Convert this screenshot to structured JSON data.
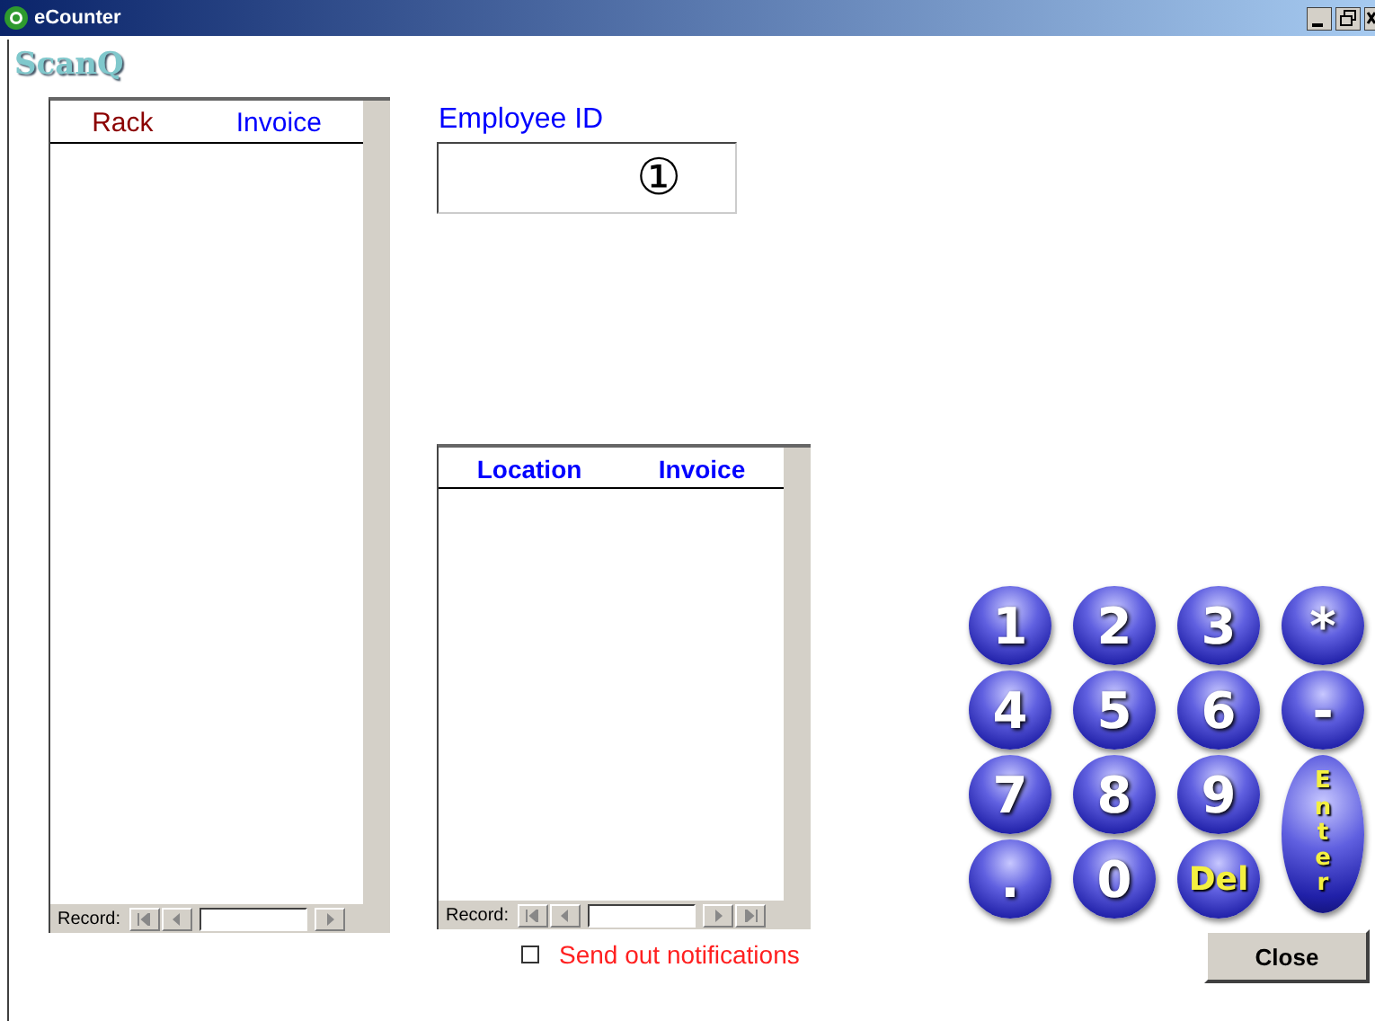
{
  "window": {
    "title": "eCounter"
  },
  "logo": "ScanQ",
  "rack_list": {
    "columns": [
      {
        "label": "Rack",
        "color": "#8b0000"
      },
      {
        "label": "Invoice",
        "color": "#0000ff"
      }
    ],
    "record_label": "Record:",
    "nav": [
      {
        "kind": "first"
      },
      {
        "kind": "prev"
      },
      {
        "kind": "input"
      },
      {
        "kind": "next"
      }
    ]
  },
  "employee": {
    "label": "Employee ID",
    "value": "①"
  },
  "location_list": {
    "columns": [
      {
        "label": "Location",
        "color": "#0000ff"
      },
      {
        "label": "Invoice",
        "color": "#0000ff"
      }
    ],
    "record_label": "Record:",
    "nav": [
      {
        "kind": "first"
      },
      {
        "kind": "prev"
      },
      {
        "kind": "input"
      },
      {
        "kind": "next"
      },
      {
        "kind": "last"
      }
    ]
  },
  "notify": {
    "label": "Send out notifications",
    "checked": false
  },
  "keypad": [
    {
      "label": "1",
      "kind": "digit"
    },
    {
      "label": "2",
      "kind": "digit"
    },
    {
      "label": "3",
      "kind": "digit"
    },
    {
      "label": "*",
      "kind": "digit"
    },
    {
      "label": "4",
      "kind": "digit"
    },
    {
      "label": "5",
      "kind": "digit"
    },
    {
      "label": "6",
      "kind": "digit"
    },
    {
      "label": "-",
      "kind": "digit"
    },
    {
      "label": "7",
      "kind": "digit"
    },
    {
      "label": "8",
      "kind": "digit"
    },
    {
      "label": "9",
      "kind": "digit"
    },
    {
      "label": "Enter",
      "kind": "enter"
    },
    {
      "label": ".",
      "kind": "digit"
    },
    {
      "label": "0",
      "kind": "digit"
    },
    {
      "label": "Del",
      "kind": "del"
    }
  ],
  "close_button": "Close"
}
